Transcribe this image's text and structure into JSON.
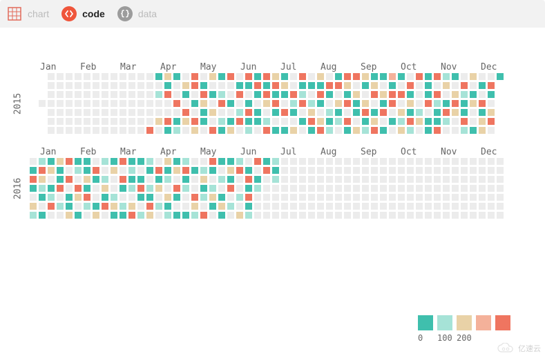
{
  "tabs": {
    "chart": {
      "label": "chart"
    },
    "code": {
      "label": "code",
      "active": true
    },
    "data": {
      "label": "data"
    }
  },
  "watermark": "亿速云",
  "chart_data": {
    "type": "heatmap",
    "layout": "calendar",
    "years": [
      {
        "year": "2015",
        "months": [
          "Jan",
          "Feb",
          "Mar",
          "Apr",
          "May",
          "Jun",
          "Jul",
          "Aug",
          "Sep",
          "Oct",
          "Nov",
          "Dec"
        ],
        "bucket_rows": [
          [
            -1,
            -1,
            0,
            0,
            0,
            0,
            0,
            0,
            0,
            0,
            0,
            0,
            0,
            0,
            1,
            3,
            1,
            0,
            5,
            0,
            3,
            1,
            5,
            0,
            5,
            1,
            5,
            3,
            1,
            0,
            5,
            0,
            3,
            0,
            1,
            5,
            5,
            3,
            1,
            1,
            4,
            1,
            0,
            5,
            1,
            5,
            2,
            1,
            0,
            3,
            0,
            0,
            1
          ],
          [
            -1,
            -1,
            0,
            0,
            0,
            0,
            0,
            0,
            0,
            0,
            0,
            0,
            0,
            0,
            0,
            1,
            0,
            3,
            5,
            1,
            0,
            0,
            0,
            1,
            1,
            5,
            1,
            5,
            3,
            0,
            1,
            1,
            1,
            5,
            5,
            3,
            0,
            1,
            3,
            0,
            1,
            0,
            5,
            0,
            1,
            0,
            3,
            0,
            5,
            0,
            1,
            5,
            -1
          ],
          [
            -1,
            -1,
            0,
            0,
            0,
            0,
            0,
            0,
            0,
            0,
            0,
            0,
            0,
            0,
            2,
            5,
            0,
            1,
            0,
            5,
            1,
            2,
            0,
            5,
            0,
            1,
            5,
            1,
            1,
            5,
            2,
            0,
            5,
            1,
            0,
            1,
            3,
            0,
            5,
            3,
            5,
            5,
            1,
            0,
            1,
            5,
            0,
            3,
            2,
            1,
            0,
            1,
            -1
          ],
          [
            -1,
            0,
            0,
            0,
            0,
            0,
            0,
            0,
            0,
            0,
            0,
            0,
            0,
            0,
            0,
            0,
            5,
            0,
            1,
            3,
            0,
            5,
            1,
            0,
            1,
            0,
            3,
            5,
            0,
            2,
            5,
            2,
            1,
            0,
            3,
            5,
            1,
            3,
            0,
            1,
            5,
            0,
            3,
            0,
            5,
            2,
            1,
            5,
            1,
            3,
            5,
            0,
            -1
          ],
          [
            -1,
            -1,
            0,
            0,
            0,
            0,
            0,
            0,
            0,
            0,
            0,
            0,
            0,
            0,
            0,
            0,
            0,
            5,
            0,
            1,
            3,
            0,
            0,
            2,
            5,
            1,
            0,
            1,
            5,
            1,
            0,
            3,
            0,
            2,
            1,
            0,
            1,
            5,
            1,
            5,
            0,
            3,
            1,
            2,
            0,
            1,
            5,
            3,
            1,
            0,
            1,
            3,
            -1
          ],
          [
            -1,
            -1,
            0,
            0,
            0,
            0,
            0,
            0,
            0,
            0,
            0,
            0,
            0,
            0,
            3,
            5,
            1,
            3,
            5,
            1,
            0,
            2,
            1,
            5,
            1,
            1,
            2,
            0,
            0,
            0,
            1,
            5,
            3,
            1,
            2,
            5,
            0,
            1,
            3,
            0,
            1,
            2,
            5,
            3,
            1,
            1,
            2,
            0,
            5,
            0,
            3,
            5,
            -1
          ],
          [
            -1,
            -1,
            0,
            0,
            0,
            0,
            0,
            0,
            0,
            0,
            0,
            0,
            0,
            5,
            0,
            1,
            2,
            0,
            3,
            0,
            5,
            1,
            3,
            0,
            2,
            0,
            5,
            1,
            1,
            3,
            0,
            1,
            5,
            2,
            0,
            1,
            3,
            2,
            5,
            1,
            0,
            3,
            2,
            0,
            1,
            5,
            0,
            0,
            2,
            1,
            3,
            0,
            -1
          ]
        ]
      },
      {
        "year": "2016",
        "months": [
          "Jan",
          "Feb",
          "Mar",
          "Apr",
          "May",
          "Jun",
          "Jul",
          "Aug",
          "Sep",
          "Oct",
          "Nov",
          "Dec"
        ],
        "bucket_rows": [
          [
            0,
            2,
            1,
            3,
            5,
            1,
            1,
            0,
            2,
            1,
            5,
            1,
            1,
            2,
            0,
            3,
            1,
            2,
            0,
            0,
            5,
            1,
            1,
            2,
            0,
            5,
            1,
            2,
            0,
            0,
            0,
            0,
            0,
            0,
            0,
            0,
            0,
            0,
            0,
            0,
            0,
            0,
            0,
            0,
            0,
            0,
            0,
            0,
            0,
            0,
            0,
            0,
            0
          ],
          [
            1,
            5,
            3,
            1,
            0,
            2,
            1,
            5,
            0,
            3,
            0,
            2,
            0,
            1,
            5,
            1,
            3,
            5,
            1,
            2,
            1,
            0,
            3,
            5,
            1,
            0,
            5,
            1,
            0,
            0,
            0,
            0,
            0,
            0,
            0,
            0,
            0,
            0,
            0,
            0,
            0,
            0,
            0,
            0,
            0,
            0,
            0,
            0,
            0,
            0,
            0,
            0,
            0
          ],
          [
            5,
            3,
            0,
            1,
            5,
            0,
            3,
            1,
            2,
            0,
            5,
            1,
            1,
            0,
            1,
            2,
            0,
            1,
            0,
            3,
            0,
            2,
            1,
            0,
            5,
            1,
            0,
            2,
            0,
            0,
            0,
            0,
            0,
            0,
            0,
            0,
            0,
            0,
            0,
            0,
            0,
            0,
            0,
            0,
            0,
            0,
            0,
            0,
            0,
            0,
            0,
            0,
            0
          ],
          [
            1,
            2,
            1,
            5,
            0,
            5,
            1,
            0,
            3,
            0,
            1,
            2,
            5,
            2,
            3,
            0,
            5,
            2,
            0,
            1,
            2,
            0,
            5,
            0,
            1,
            2,
            0,
            0,
            0,
            0,
            0,
            0,
            0,
            0,
            0,
            0,
            0,
            0,
            0,
            0,
            0,
            0,
            0,
            0,
            0,
            0,
            0,
            0,
            0,
            0,
            0,
            0,
            0
          ],
          [
            0,
            1,
            2,
            0,
            1,
            3,
            5,
            0,
            1,
            2,
            0,
            0,
            1,
            1,
            0,
            3,
            1,
            0,
            5,
            2,
            3,
            1,
            0,
            2,
            5,
            0,
            0,
            0,
            0,
            0,
            0,
            0,
            0,
            0,
            0,
            0,
            0,
            0,
            0,
            0,
            0,
            0,
            0,
            0,
            0,
            0,
            0,
            0,
            0,
            0,
            0,
            0,
            0
          ],
          [
            3,
            0,
            5,
            2,
            1,
            0,
            2,
            1,
            5,
            3,
            2,
            3,
            0,
            5,
            2,
            1,
            0,
            0,
            3,
            0,
            1,
            3,
            2,
            0,
            1,
            0,
            0,
            0,
            0,
            0,
            0,
            0,
            0,
            0,
            0,
            0,
            0,
            0,
            0,
            0,
            0,
            0,
            0,
            0,
            0,
            0,
            0,
            0,
            0,
            0,
            0,
            0,
            0
          ],
          [
            2,
            1,
            0,
            0,
            3,
            1,
            0,
            3,
            0,
            1,
            1,
            5,
            2,
            3,
            0,
            2,
            1,
            1,
            2,
            5,
            0,
            1,
            0,
            3,
            2,
            0,
            0,
            0,
            0,
            0,
            0,
            0,
            0,
            0,
            0,
            0,
            0,
            0,
            0,
            0,
            0,
            0,
            0,
            0,
            0,
            0,
            0,
            0,
            0,
            0,
            0,
            0,
            0
          ]
        ]
      }
    ],
    "legend": {
      "ticks": [
        "0",
        "100",
        "200"
      ],
      "buckets": [
        {
          "color": "#3fbfad",
          "from": 0,
          "to": 50
        },
        {
          "color": "#a6e3d7",
          "from": 50,
          "to": 100
        },
        {
          "color": "#e9d2a7",
          "from": 100,
          "to": 150
        },
        {
          "color": "#f4b19a",
          "from": 150,
          "to": 200
        },
        {
          "color": "#ef7560",
          "from": 200,
          "to": 250
        }
      ]
    }
  }
}
